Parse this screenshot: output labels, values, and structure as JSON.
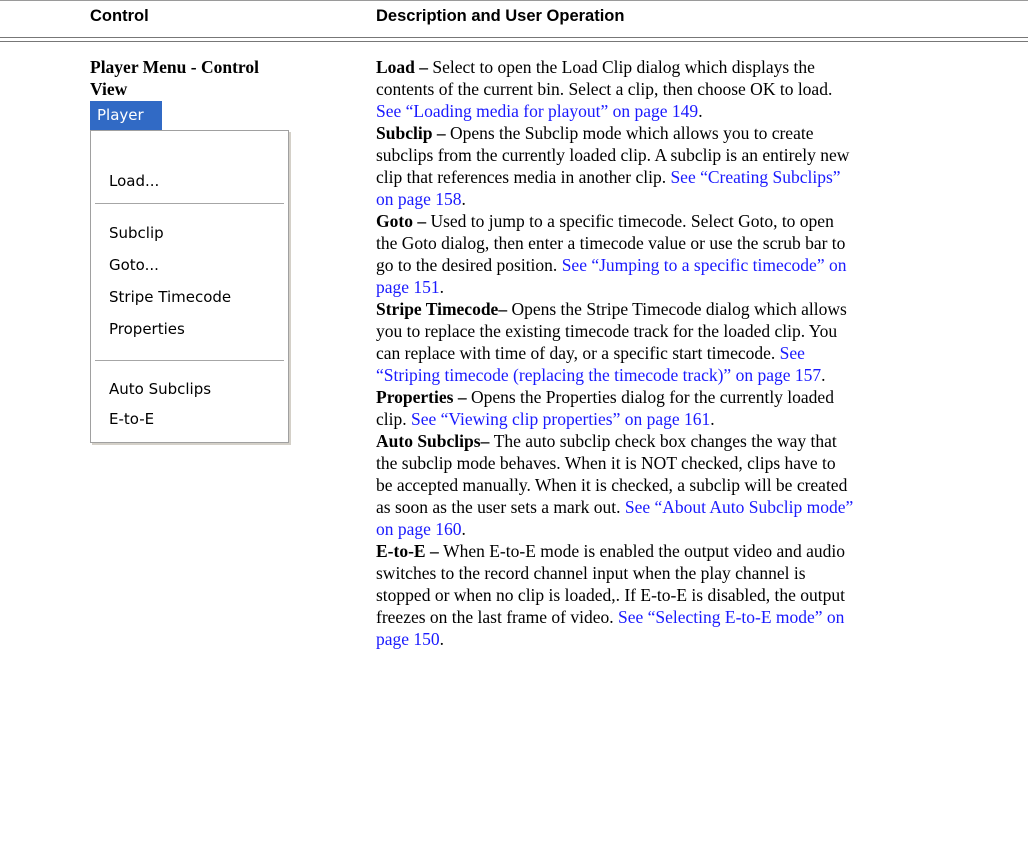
{
  "header": {
    "control_label": "Control",
    "description_label": "Description and User Operation"
  },
  "control": {
    "title_line1": "Player Menu - Control",
    "title_line2": "View"
  },
  "menu": {
    "bar_label": "Player",
    "items": {
      "load": "Load...",
      "subclip": "Subclip",
      "goto": "Goto...",
      "stripe_timecode": "Stripe Timecode",
      "properties": "Properties",
      "auto_subclips": "Auto Subclips",
      "e_to_e": "E-to-E"
    }
  },
  "descriptions": {
    "load": {
      "term": "Load",
      "sep": " – ",
      "l1": "Select to open the Load Clip dialog which displays the",
      "l2": "contents of the current bin. Select a clip, then choose OK to load.",
      "link": "See “Loading media for playout” on page 149",
      "end": "."
    },
    "subclip": {
      "term": "Subclip",
      "sep": " – ",
      "l1": "Opens the Subclip mode which allows you to create",
      "l2": "subclips from the currently loaded clip. A subclip is an entirely new",
      "l3": "clip that references media in another clip. ",
      "link1": "See “Creating Subclips”",
      "link2": "on page 158",
      "end": "."
    },
    "goto": {
      "term": "Goto",
      "sep": " – ",
      "l1": "Used to jump to a specific timecode. Select Goto, to open",
      "l2": "the Goto dialog, then enter a timecode value or use the scrub bar to",
      "l3": "go to the desired position. ",
      "link1": "See “Jumping to a specific timecode” on",
      "link2": "page 151",
      "end": "."
    },
    "stripe_timecode": {
      "term": "Stripe Timecode",
      "sep": "– ",
      "l1": "Opens the Stripe Timecode dialog which allows",
      "l2": "you to replace the existing timecode track for the loaded clip. You",
      "l3": "can replace with time of day, or a specific start timecode. ",
      "link1": "See",
      "link2": "“Striping timecode (replacing the timecode track)” on page 157",
      "end": "."
    },
    "properties": {
      "term": "Properties",
      "sep": " – ",
      "l1": "Opens the Properties dialog for the currently loaded",
      "l2": "clip. ",
      "link": "See “Viewing clip properties” on page 161",
      "end": "."
    },
    "auto_subclips": {
      "term": "Auto Subclips",
      "sep": "– ",
      "l1": "The auto subclip check box changes the way that",
      "l2": "the subclip mode behaves. When it is NOT checked, clips have to",
      "l3": "be accepted manually. When it is checked, a subclip will be created",
      "l4": "as soon as the user sets a mark out. ",
      "link1": "See “About Auto Subclip mode”",
      "link2": "on page 160",
      "end": "."
    },
    "e_to_e": {
      "term": "E-to-E",
      "sep": " – ",
      "l1": "When E-to-E mode is enabled the output video and audio",
      "l2": "switches to the record channel input when the play channel is",
      "l3": "stopped or when no clip is loaded,. If E-to-E is disabled, the output",
      "l4": "freezes on the last frame of video. ",
      "link1": "See “Selecting E-to-E mode” on",
      "link2": "page 150",
      "end": "."
    }
  }
}
